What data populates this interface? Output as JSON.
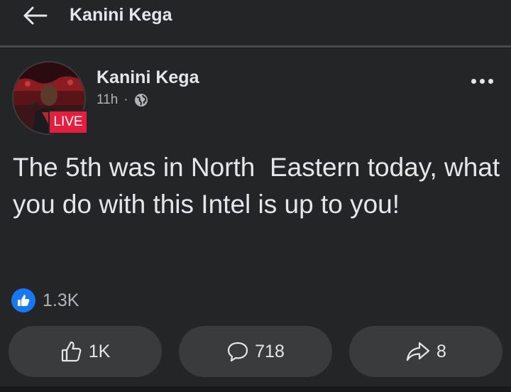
{
  "header": {
    "title": "Kanini Kega",
    "back_icon": "arrow-left-icon"
  },
  "post": {
    "author": "Kanini Kega",
    "live_label": "LIVE",
    "time": "11h",
    "separator": "·",
    "audience_icon": "globe-icon",
    "text": "The 5th was in North  Eastern today, what you do with this Intel is up to you!",
    "reactions": {
      "icon": "like-icon",
      "count": "1.3K"
    },
    "actions": {
      "like_count": "1K",
      "comment_count": "718",
      "share_count": "8"
    }
  },
  "colors": {
    "background": "#242526",
    "button": "#3a3b3c",
    "like_blue": "#1877f2",
    "live_red": "#e41e3f",
    "secondary_text": "#b0b3b8"
  }
}
